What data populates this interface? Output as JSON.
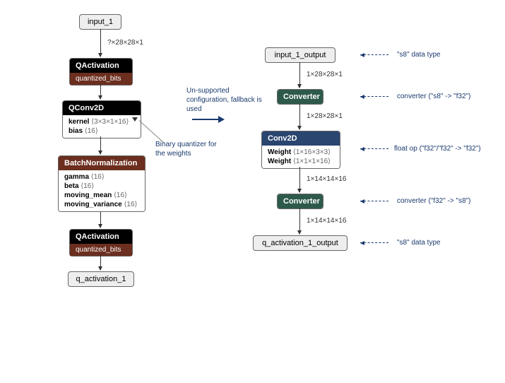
{
  "left": {
    "input": "input_1",
    "edge1": "?×28×28×1",
    "qact1_title": "QActivation",
    "qact1_sub": "quantized_bits",
    "qconv_title": "QConv2D",
    "qconv_kernel_label": "kernel",
    "qconv_kernel_shape": "⟨3×3×1×16⟩",
    "qconv_bias_label": "bias",
    "qconv_bias_shape": "⟨16⟩",
    "bn_title": "BatchNormalization",
    "bn_gamma_label": "gamma",
    "bn_gamma_shape": "⟨16⟩",
    "bn_beta_label": "beta",
    "bn_beta_shape": "⟨16⟩",
    "bn_mm_label": "moving_mean",
    "bn_mm_shape": "⟨16⟩",
    "bn_mv_label": "moving_variance",
    "bn_mv_shape": "⟨16⟩",
    "qact2_title": "QActivation",
    "qact2_sub": "quantized_bits",
    "output": "q_activation_1"
  },
  "right": {
    "input": "input_1_output",
    "edge1": "1×28×28×1",
    "conv1": "Converter",
    "edge2": "1×28×28×1",
    "conv2d_title": "Conv2D",
    "conv2d_w1_label": "Weight",
    "conv2d_w1_shape": "⟨1×16×3×3⟩",
    "conv2d_w2_label": "Weight",
    "conv2d_w2_shape": "⟨1×1×1×16⟩",
    "edge3": "1×14×14×16",
    "conv2": "Converter",
    "edge4": "1×14×14×16",
    "output": "q_activation_1_output"
  },
  "annotations": {
    "unsupported": "Un-supported configuration, fallback is used",
    "binary": "Binary quantizer for the weights",
    "s8_type": "\"s8\" data type",
    "conv_s8_f32": "converter (\"s8\" -> \"f32\")",
    "float_op": "float op (\"f32\"/\"f32\" -> \"f32\")",
    "conv_f32_s8": "converter (\"f32\" -> \"s8\")"
  }
}
